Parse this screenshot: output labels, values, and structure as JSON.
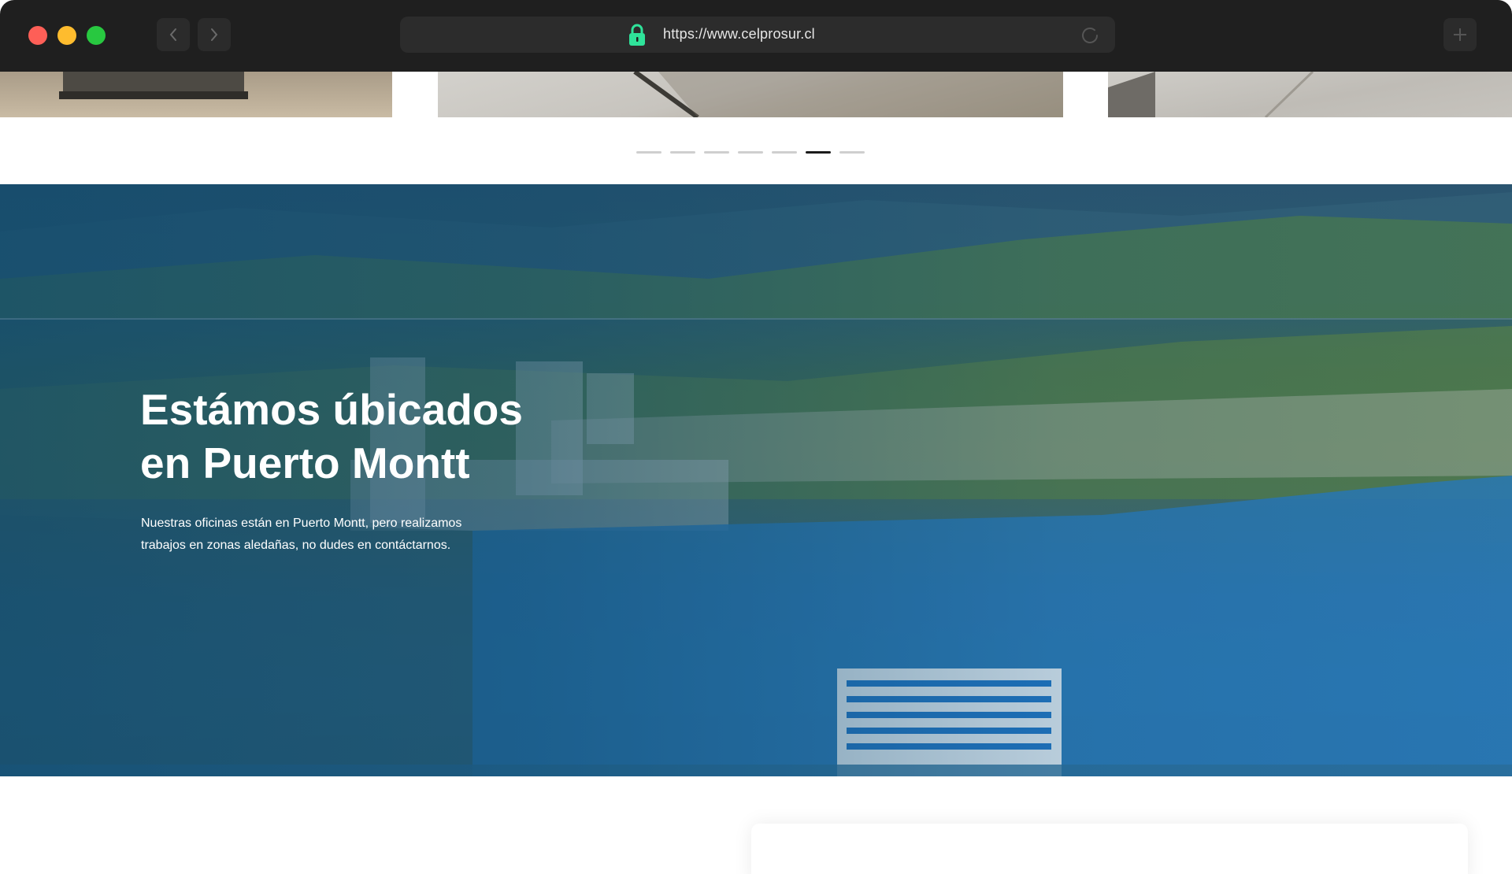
{
  "browser": {
    "url": "https://www.celprosur.cl",
    "icons": {
      "back": "chevron-left-icon",
      "forward": "chevron-right-icon",
      "lock": "lock-icon",
      "reload": "reload-icon",
      "new_tab": "plus-icon"
    },
    "lock_color": "#2fe39a"
  },
  "carousel": {
    "slide_count": 7,
    "active_index": 5
  },
  "hero": {
    "title_line1": "Estámos úbicados",
    "title_line2": "en Puerto Montt",
    "description": "Nuestras oficinas están en Puerto Montt, pero realizamos trabajos en zonas aledañas, no dudes en contáctarnos."
  }
}
